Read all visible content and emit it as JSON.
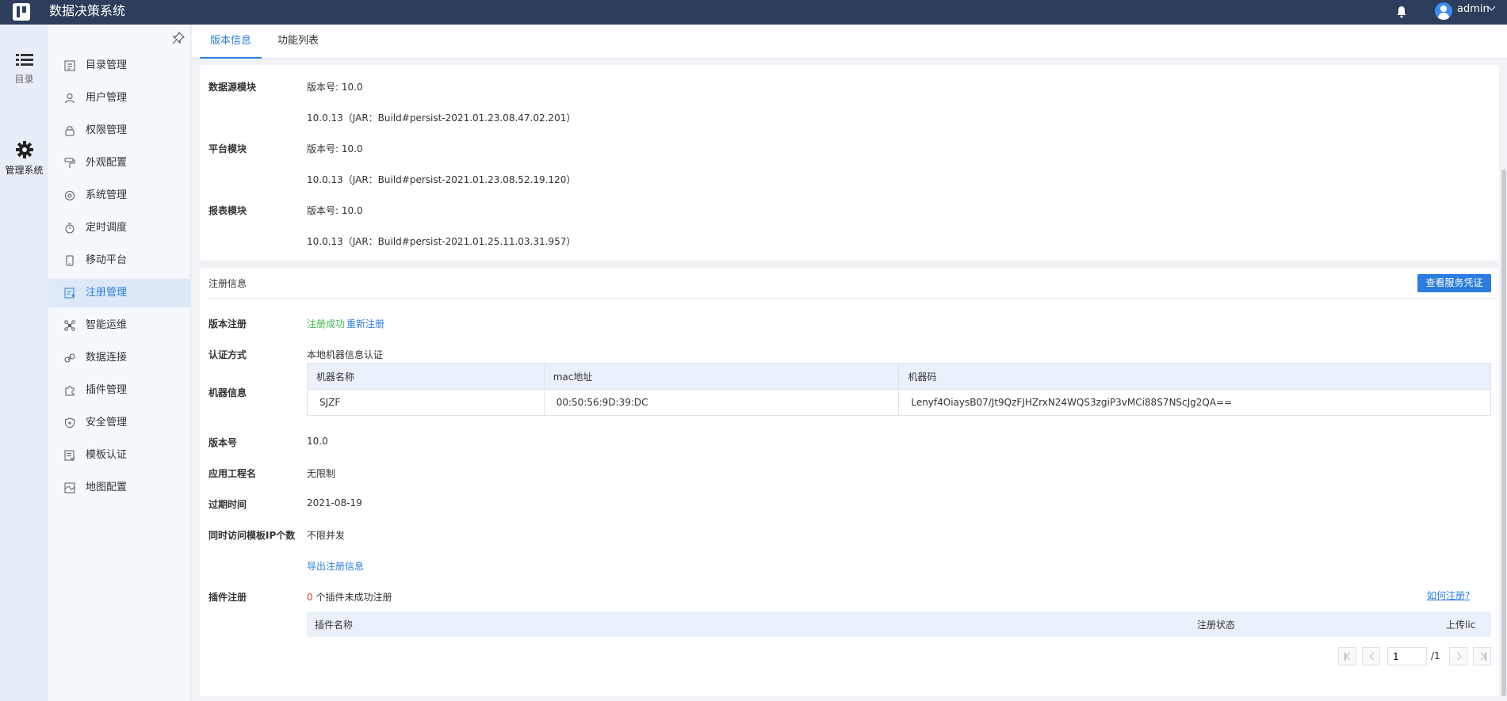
{
  "app": {
    "title": "数据决策系统"
  },
  "header": {
    "user": "admin"
  },
  "rail": [
    {
      "label": "目录",
      "icon": "list-icon"
    },
    {
      "label": "管理系统",
      "icon": "gear-icon"
    }
  ],
  "menu": [
    {
      "label": "目录管理",
      "icon": "directory-icon"
    },
    {
      "label": "用户管理",
      "icon": "user-icon"
    },
    {
      "label": "权限管理",
      "icon": "lock-icon"
    },
    {
      "label": "外观配置",
      "icon": "paint-roller-icon"
    },
    {
      "label": "系统管理",
      "icon": "settings-icon"
    },
    {
      "label": "定时调度",
      "icon": "stopwatch-icon"
    },
    {
      "label": "移动平台",
      "icon": "mobile-icon"
    },
    {
      "label": "注册管理",
      "icon": "register-icon"
    },
    {
      "label": "智能运维",
      "icon": "network-icon"
    },
    {
      "label": "数据连接",
      "icon": "link-icon"
    },
    {
      "label": "插件管理",
      "icon": "puzzle-icon"
    },
    {
      "label": "安全管理",
      "icon": "shield-icon"
    },
    {
      "label": "模板认证",
      "icon": "template-icon"
    },
    {
      "label": "地图配置",
      "icon": "map-icon"
    }
  ],
  "tabs": {
    "version_info": "版本信息",
    "feature_list": "功能列表"
  },
  "modules": [
    {
      "name": "数据源模块",
      "version": "版本号: 10.0",
      "build": "10.0.13（JAR：Build#persist-2021.01.23.08.47.02.201）"
    },
    {
      "name": "平台模块",
      "version": "版本号: 10.0",
      "build": "10.0.13（JAR：Build#persist-2021.01.23.08.52.19.120）"
    },
    {
      "name": "报表模块",
      "version": "版本号: 10.0",
      "build": "10.0.13（JAR：Build#persist-2021.01.25.11.03.31.957）"
    }
  ],
  "registration": {
    "title": "注册信息",
    "view_credential": "查看服务凭证",
    "version_reg_label": "版本注册",
    "reg_success": "注册成功",
    "reregister": "重新注册",
    "auth_label": "认证方式",
    "auth_value": "本地机器信息认证",
    "machine_label": "机器信息",
    "machine_cols": [
      "机器名称",
      "mac地址",
      "机器码"
    ],
    "machine_row": [
      "SJZF",
      "00:50:56:9D:39:DC",
      "Lenyf4OiaysB07/Jt9QzFJHZrxN24WQS3zgiP3vMCi88S7NScJg2QA=="
    ],
    "version_label": "版本号",
    "version_value": "10.0",
    "app_name_label": "应用工程名",
    "app_name_value": "无限制",
    "expire_label": "过期时间",
    "expire_value": "2021-08-19",
    "ip_label": "同时访问模板IP个数",
    "ip_value": "不限并发",
    "export_link": "导出注册信息",
    "plugin_label": "插件注册",
    "plugin_count": "0",
    "plugin_text": " 个插件未成功注册",
    "how_register": "如何注册?",
    "plugin_cols": [
      "插件名称",
      "注册状态",
      "上传lic"
    ],
    "page_input": "1",
    "page_total": "/1"
  },
  "colors": {
    "accent": "#2b7de1",
    "topbar": "#2c3e5c",
    "success": "#3fb950",
    "danger": "#e53935"
  }
}
